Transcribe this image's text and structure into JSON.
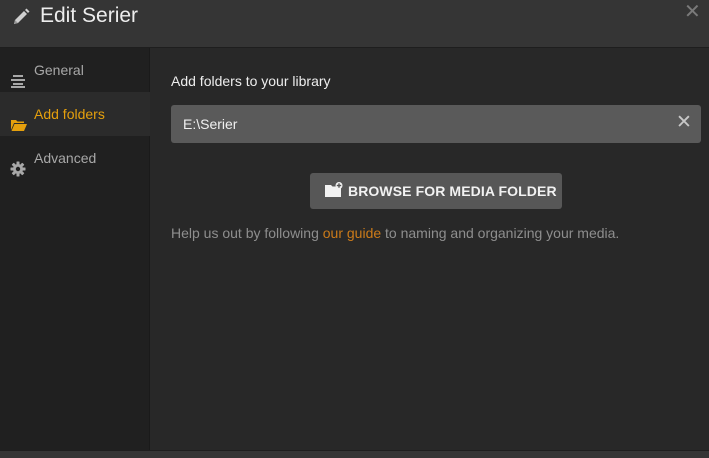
{
  "header": {
    "title": "Edit Serier",
    "edit_icon": "pencil-icon",
    "close_icon": "close-icon",
    "close_glyph": "✕"
  },
  "sidebar": {
    "items": [
      {
        "label": "General",
        "icon": "align-lines-icon",
        "active": false
      },
      {
        "label": "Add folders",
        "icon": "folder-open-icon",
        "active": true
      },
      {
        "label": "Advanced",
        "icon": "gear-icon",
        "active": false
      }
    ]
  },
  "main": {
    "section_label": "Add folders to your library",
    "folders": [
      {
        "path": "E:\\Serier",
        "remove_glyph": "✕"
      }
    ],
    "browse_button": {
      "label": "BROWSE FOR MEDIA FOLDER",
      "icon": "add-folder-icon"
    },
    "help": {
      "before": "Help us out by following ",
      "link": "our guide",
      "after": " to naming and organizing your media."
    }
  },
  "colors": {
    "accent": "#e5a00d",
    "link": "#cc7b19",
    "background": "#282828",
    "sidebar": "#202020"
  }
}
